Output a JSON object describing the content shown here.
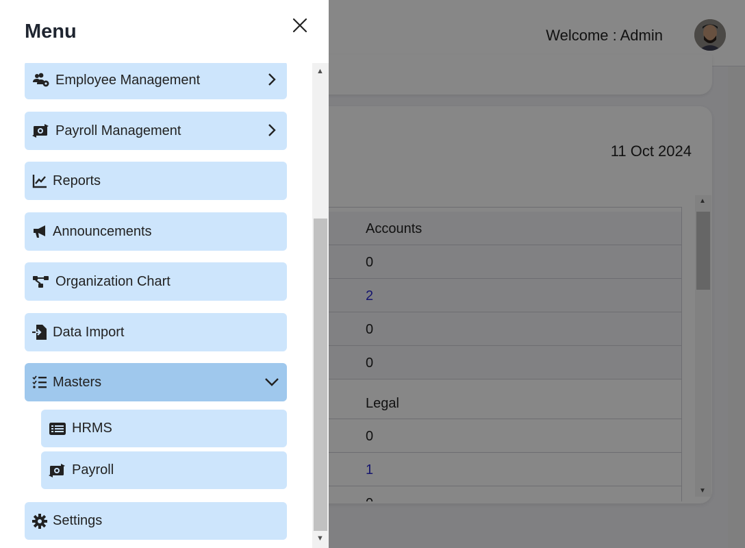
{
  "header": {
    "welcome_text": "Welcome : Admin",
    "avatar_icon": "user-avatar"
  },
  "dashboard": {
    "date": "11 Oct 2024",
    "table_rows": [
      {
        "text": "Accounts",
        "kind": "head"
      },
      {
        "text": "0",
        "kind": "value"
      },
      {
        "text": "2",
        "kind": "link"
      },
      {
        "text": "0",
        "kind": "value"
      },
      {
        "text": "0",
        "kind": "value"
      },
      {
        "text": "Legal",
        "kind": "section"
      },
      {
        "text": "0",
        "kind": "value"
      },
      {
        "text": "1",
        "kind": "link"
      },
      {
        "text": "0",
        "kind": "value"
      }
    ]
  },
  "menu": {
    "title": "Menu",
    "close_icon": "close-icon",
    "items": [
      {
        "label": "Employee Management",
        "icon": "users-gear-icon",
        "chevron": "right"
      },
      {
        "label": "Payroll Management",
        "icon": "money-bill-transfer-icon",
        "chevron": "right"
      },
      {
        "label": "Reports",
        "icon": "line-chart-icon"
      },
      {
        "label": "Announcements",
        "icon": "bullhorn-icon"
      },
      {
        "label": "Organization Chart",
        "icon": "sitemap-icon"
      },
      {
        "label": "Data Import",
        "icon": "file-import-icon"
      },
      {
        "label": "Masters",
        "icon": "list-check-icon",
        "chevron": "down",
        "active": true
      },
      {
        "label": "HRMS",
        "icon": "table-list-icon",
        "sub": true
      },
      {
        "label": "Payroll",
        "icon": "money-bill-transfer-icon",
        "sub": true
      },
      {
        "label": "Settings",
        "icon": "gear-icon"
      }
    ]
  },
  "colors": {
    "menu_item_bg": "#cde5fc",
    "menu_item_active_bg": "#9fc8ed",
    "link_color": "#2a2ad0"
  }
}
